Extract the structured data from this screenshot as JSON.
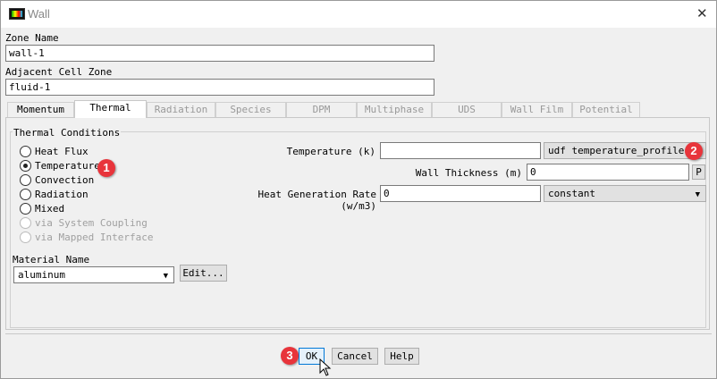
{
  "window": {
    "title": "Wall",
    "close_icon": "close-icon"
  },
  "zone_name": {
    "label": "Zone Name",
    "value": "wall-1"
  },
  "adjacent": {
    "label": "Adjacent Cell Zone",
    "value": "fluid-1"
  },
  "tabs": [
    {
      "label": "Momentum"
    },
    {
      "label": "Thermal"
    },
    {
      "label": "Radiation"
    },
    {
      "label": "Species"
    },
    {
      "label": "DPM"
    },
    {
      "label": "Multiphase"
    },
    {
      "label": "UDS"
    },
    {
      "label": "Wall Film"
    },
    {
      "label": "Potential"
    }
  ],
  "thermal": {
    "group_label": "Thermal Conditions",
    "options": [
      {
        "label": "Heat Flux"
      },
      {
        "label": "Temperature"
      },
      {
        "label": "Convection"
      },
      {
        "label": "Radiation"
      },
      {
        "label": "Mixed"
      },
      {
        "label": "via System Coupling"
      },
      {
        "label": "via Mapped Interface"
      }
    ],
    "temperature_label": "Temperature (k)",
    "temperature_value": "",
    "temperature_profile": "udf temperature_profile",
    "wall_thickness_label": "Wall Thickness (m)",
    "wall_thickness_value": "0",
    "p_button": "P",
    "heat_gen_label": "Heat Generation Rate (w/m3)",
    "heat_gen_value": "0",
    "heat_gen_method": "constant",
    "material_label": "Material Name",
    "material_value": "aluminum",
    "edit_button": "Edit..."
  },
  "buttons": {
    "ok": "OK",
    "cancel": "Cancel",
    "help": "Help"
  },
  "badges": [
    "1",
    "2",
    "3"
  ],
  "accent_color": "#e8343b"
}
